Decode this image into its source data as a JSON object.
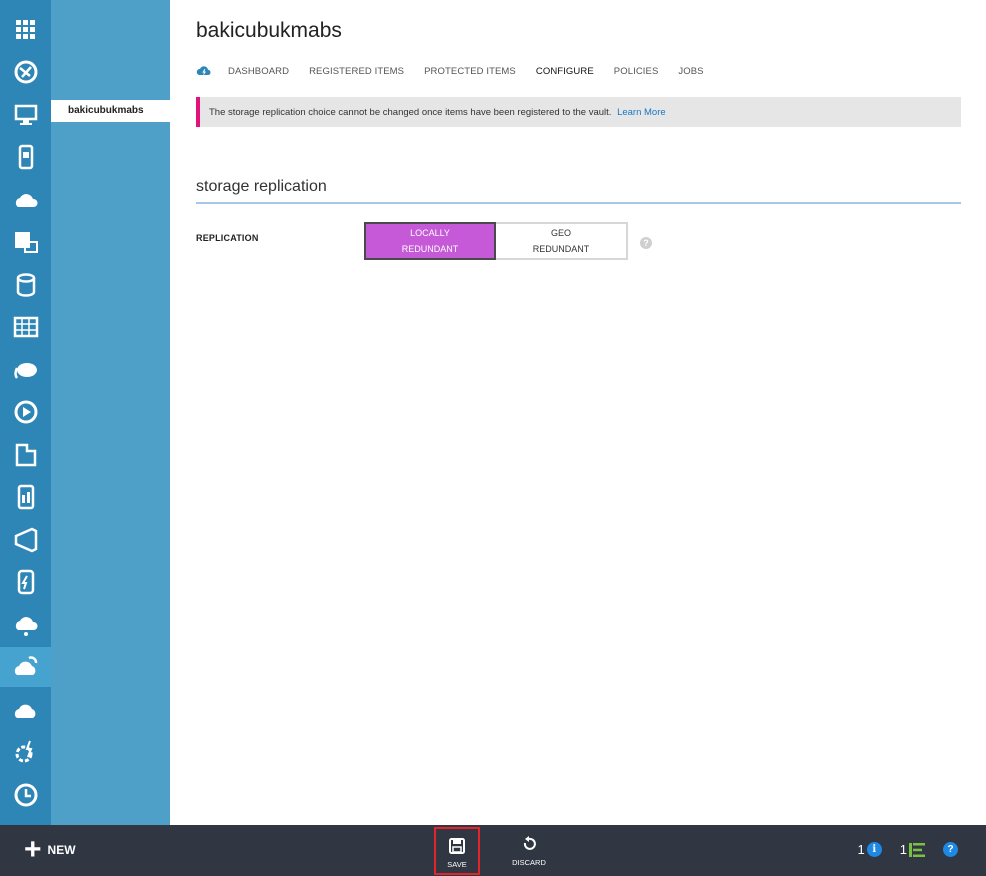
{
  "rail": {
    "icons": [
      "all-items-icon",
      "web-sites-icon",
      "virtual-machines-icon",
      "mobile-services-icon",
      "cloud-services-icon",
      "batch-icon",
      "sql-databases-icon",
      "storage-icon",
      "hdinsight-icon",
      "media-services-icon",
      "service-bus-icon",
      "mobile-engagement-icon",
      "visual-studio-icon",
      "cache-icon",
      "biztalk-icon",
      "recovery-services-icon",
      "cdn-icon",
      "automation-icon",
      "scheduler-icon"
    ],
    "active_index": 15
  },
  "subnav": {
    "item_label": "bakicubukmabs"
  },
  "header": {
    "title": "bakicubukmabs",
    "tabs": [
      {
        "label": "DASHBOARD",
        "active": false
      },
      {
        "label": "REGISTERED ITEMS",
        "active": false
      },
      {
        "label": "PROTECTED ITEMS",
        "active": false
      },
      {
        "label": "CONFIGURE",
        "active": true
      },
      {
        "label": "POLICIES",
        "active": false
      },
      {
        "label": "JOBS",
        "active": false
      }
    ]
  },
  "notice": {
    "text": "The storage replication choice cannot be changed once items have been registered to the vault.",
    "link": "Learn More",
    "accent": "#e2117b"
  },
  "section": {
    "title": "storage replication"
  },
  "replication": {
    "label": "REPLICATION",
    "options": [
      {
        "line1": "LOCALLY",
        "line2": "REDUNDANT",
        "selected": true
      },
      {
        "line1": "GEO",
        "line2": "REDUNDANT",
        "selected": false
      }
    ],
    "selected_color": "#c559d8",
    "help": "?"
  },
  "cmdbar": {
    "new_label": "NEW",
    "save_label": "SAVE",
    "discard_label": "DISCARD",
    "info_count": "1",
    "info_glyph": "i",
    "ops_count": "1",
    "help_glyph": "?"
  }
}
